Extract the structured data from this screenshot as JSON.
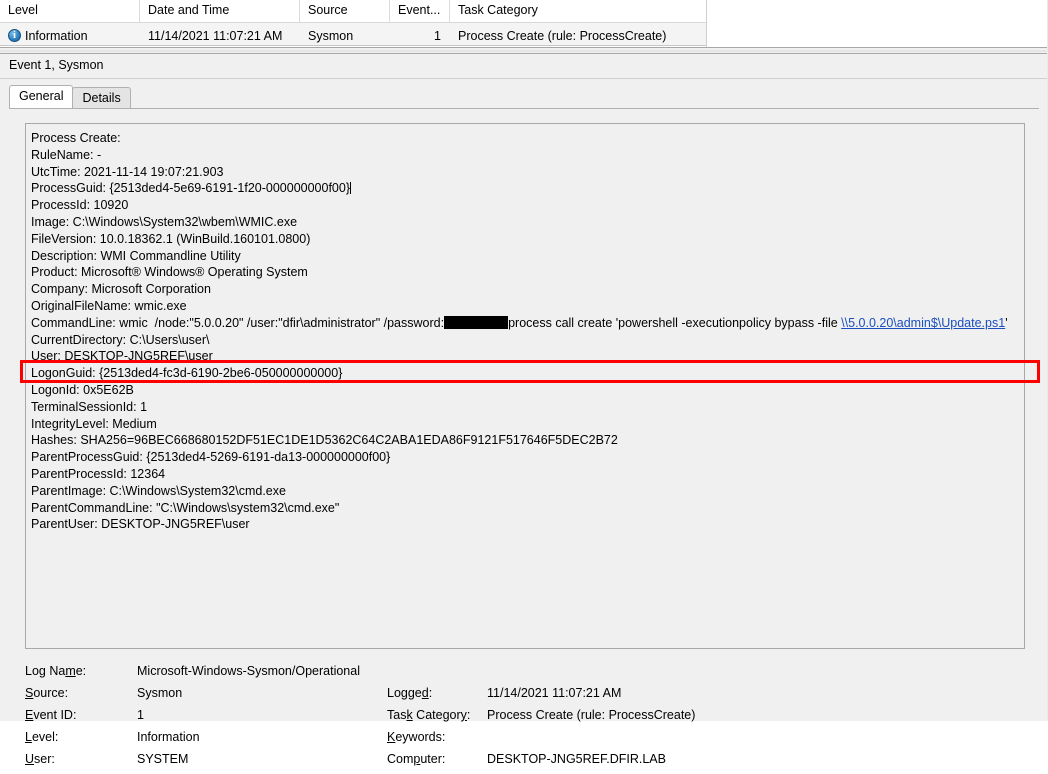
{
  "event_list": {
    "columns": [
      {
        "label": "Level",
        "key": "level"
      },
      {
        "label": "Date and Time",
        "key": "date"
      },
      {
        "label": "Source",
        "key": "source"
      },
      {
        "label": "Event...",
        "key": "event_id"
      },
      {
        "label": "Task Category",
        "key": "task"
      }
    ],
    "rows": [
      {
        "icon": "information-icon",
        "level": "Information",
        "date": "11/14/2021 11:07:21 AM",
        "source": "Sysmon",
        "event_id": "1",
        "task": "Process Create (rule: ProcessCreate)"
      }
    ]
  },
  "detail": {
    "title": "Event 1, Sysmon",
    "tabs": [
      {
        "label": "General",
        "active": true
      },
      {
        "label": "Details",
        "active": false
      }
    ],
    "body_lines": [
      "Process Create:",
      "RuleName: -",
      "UtcTime: 2021-11-14 19:07:21.903",
      "ProcessGuid: {2513ded4-5e69-6191-1f20-000000000f00}",
      "ProcessId: 10920",
      "Image: C:\\Windows\\System32\\wbem\\WMIC.exe",
      "FileVersion: 10.0.18362.1 (WinBuild.160101.0800)",
      "Description: WMI Commandline Utility",
      "Product: Microsoft® Windows® Operating System",
      "Company: Microsoft Corporation",
      "OriginalFileName: wmic.exe"
    ],
    "command_line": {
      "prefix": "CommandLine: wmic  /node:\"5.0.0.20\" /user:\"dfir\\administrator\" /password:",
      "redacted": "redacted-password",
      "middle": "process call create 'powershell -executionpolicy bypass -file ",
      "link": "\\\\5.0.0.20\\admin$\\Update.ps1",
      "suffix": "'"
    },
    "body_lines_after": [
      "CurrentDirectory: C:\\Users\\user\\",
      "User: DESKTOP-JNG5REF\\user",
      "LogonGuid: {2513ded4-fc3d-6190-2be6-050000000000}",
      "LogonId: 0x5E62B",
      "TerminalSessionId: 1",
      "IntegrityLevel: Medium",
      "Hashes: SHA256=96BEC668680152DF51EC1DE1D5362C64C2ABA1EDA86F9121F517646F5DEC2B72",
      "ParentProcessGuid: {2513ded4-5269-6191-da13-000000000f00}",
      "ParentProcessId: 12364",
      "ParentImage: C:\\Windows\\System32\\cmd.exe",
      "ParentCommandLine: \"C:\\Windows\\system32\\cmd.exe\"",
      "ParentUser: DESKTOP-JNG5REF\\user"
    ],
    "highlight_color": "#ff0000"
  },
  "meta": {
    "log_name_label": "Log Name:",
    "log_name_value": "Microsoft-Windows-Sysmon/Operational",
    "source_label": "Source:",
    "source_value": "Sysmon",
    "logged_label": "Logged:",
    "logged_value": "11/14/2021 11:07:21 AM",
    "event_id_label": "Event ID:",
    "event_id_value": "1",
    "task_category_label": "Task Category:",
    "task_category_value": "Process Create (rule: ProcessCreate)",
    "level_label": "Level:",
    "level_value": "Information",
    "keywords_label": "Keywords:",
    "keywords_value": "",
    "user_label": "User:",
    "user_value": "SYSTEM",
    "computer_label": "Computer:",
    "computer_value": "DESKTOP-JNG5REF.DFIR.LAB"
  }
}
